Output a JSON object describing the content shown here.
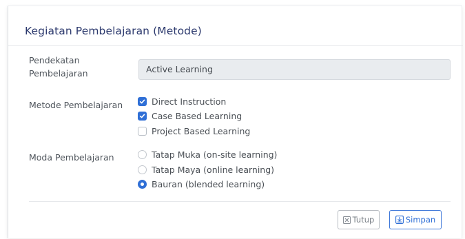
{
  "panel": {
    "title": "Kegiatan Pembelajaran (Metode)"
  },
  "approach": {
    "label": "Pendekatan Pembelajaran",
    "value": "Active Learning"
  },
  "method": {
    "label": "Metode Pembelajaran",
    "options": [
      {
        "label": "Direct Instruction",
        "checked": true
      },
      {
        "label": "Case Based Learning",
        "checked": true
      },
      {
        "label": "Project Based Learning",
        "checked": false
      }
    ]
  },
  "mode": {
    "label": "Moda Pembelajaran",
    "options": [
      {
        "label": "Tatap Muka (on-site learning)",
        "selected": false
      },
      {
        "label": "Tatap Maya (online learning)",
        "selected": false
      },
      {
        "label": "Bauran (blended learning)",
        "selected": true
      }
    ]
  },
  "actions": {
    "close_label": "Tutup",
    "close_icon": "close-box-icon",
    "save_label": "Simpan",
    "save_icon": "save-download-icon"
  },
  "colors": {
    "accent": "#2f6fd6",
    "title": "#2d3a6e",
    "readonly_bg": "#e9ecef"
  }
}
